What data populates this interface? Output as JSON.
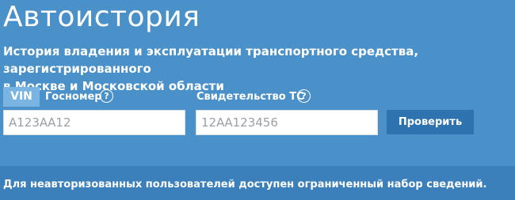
{
  "header": {
    "title": "Автоистория",
    "subtitle": "История владения и эксплуатации транспортного средства, зарегистрированного\nв Москве и Московской области"
  },
  "search": {
    "tab_vin": "VIN",
    "tab_gosnomer": "Госномер",
    "help_glyph": "?",
    "gosnomer_placeholder": "А123АА12",
    "sts_label": "Свидетельство ТС",
    "sts_placeholder": "12АА123456",
    "submit_label": "Проверить"
  },
  "footer": {
    "notice": "Для неавторизованных пользователей доступен ограниченный набор сведений."
  },
  "colors": {
    "background": "#4a90c9",
    "active_tab": "#79b4e2",
    "button": "#2e72b0",
    "footer_band": "#3b80ba"
  }
}
